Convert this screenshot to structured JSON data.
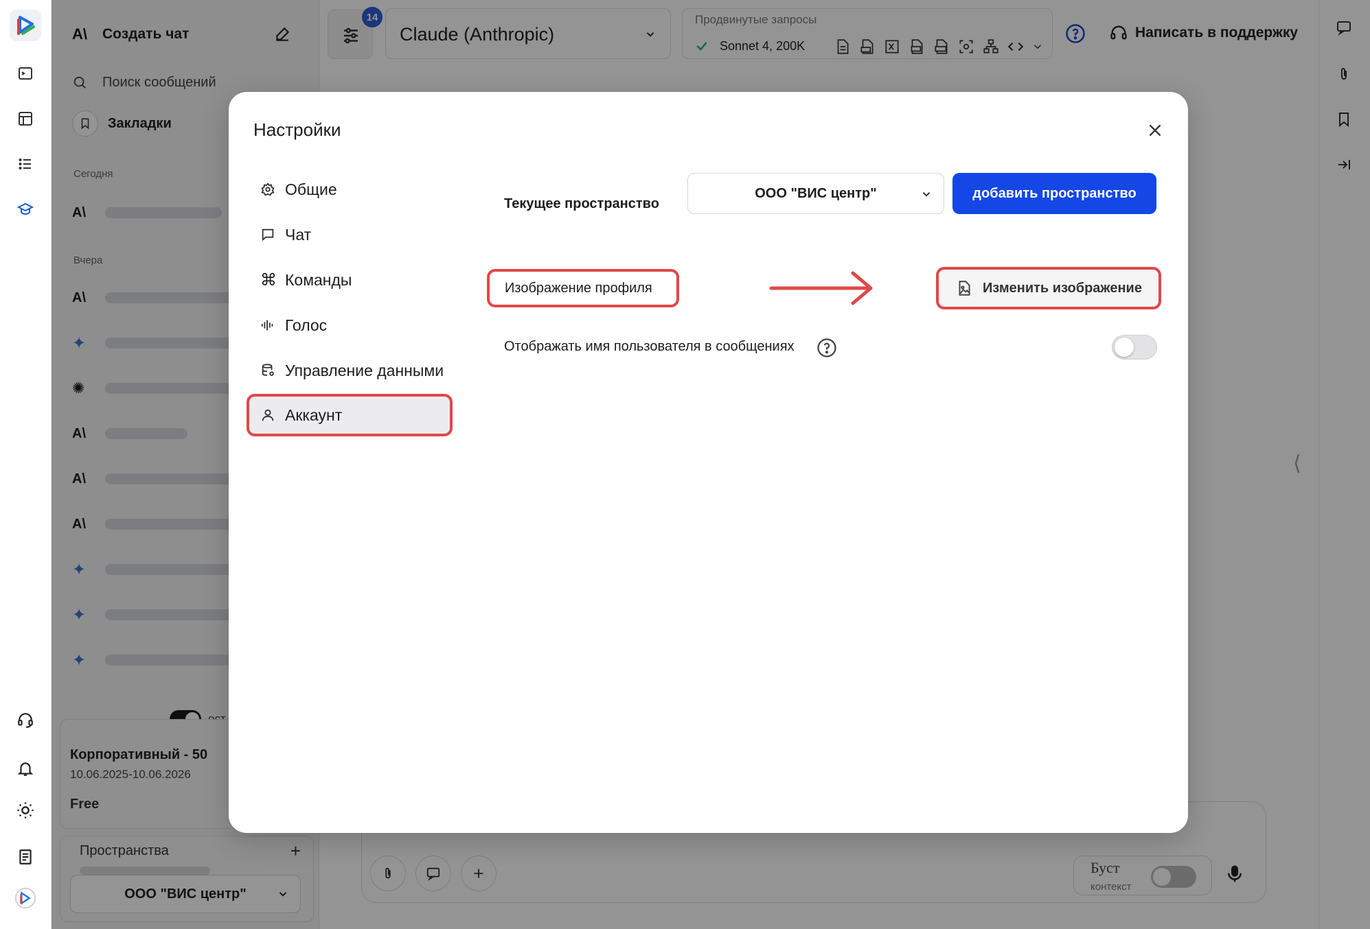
{
  "sidebar": {
    "create_chat": "Создать чат",
    "search_placeholder": "Поиск сообщений",
    "bookmarks": "Закладки",
    "section_today": "Сегодня",
    "section_yesterday": "Вчера",
    "toggle_label": "ост",
    "plan_name": "Корпоративный - 50",
    "plan_dates": "10.06.2025-10.06.2026",
    "plan_tier": "Free",
    "spaces_label": "Пространства",
    "space_add": "+",
    "space_selected": "ООО \"ВИС центр\""
  },
  "header": {
    "badge": "14",
    "model": "Claude (Anthropic)",
    "advanced_label": "Продвинутые запросы",
    "advanced_value": "Sonnet 4, 200K",
    "support": "Написать в поддержку"
  },
  "composer": {
    "boost_label": "Буст",
    "boost_sub": "контекст"
  },
  "modal": {
    "title": "Настройки",
    "nav": [
      {
        "label": "Общие"
      },
      {
        "label": "Чат"
      },
      {
        "label": "Команды"
      },
      {
        "label": "Голос"
      },
      {
        "label": "Управление данными"
      },
      {
        "label": "Аккаунт"
      }
    ],
    "current_space_label": "Текущее пространство",
    "current_space_value": "ООО \"ВИС центр\"",
    "add_space_button": "добавить пространство",
    "profile_image_label": "Изображение профиля",
    "change_image_button": "Изменить изображение",
    "show_username_label": "Отображать имя пользователя в сообщениях",
    "show_username_enabled": false
  },
  "colors": {
    "accent": "#1447e6",
    "highlight": "#e04848"
  }
}
